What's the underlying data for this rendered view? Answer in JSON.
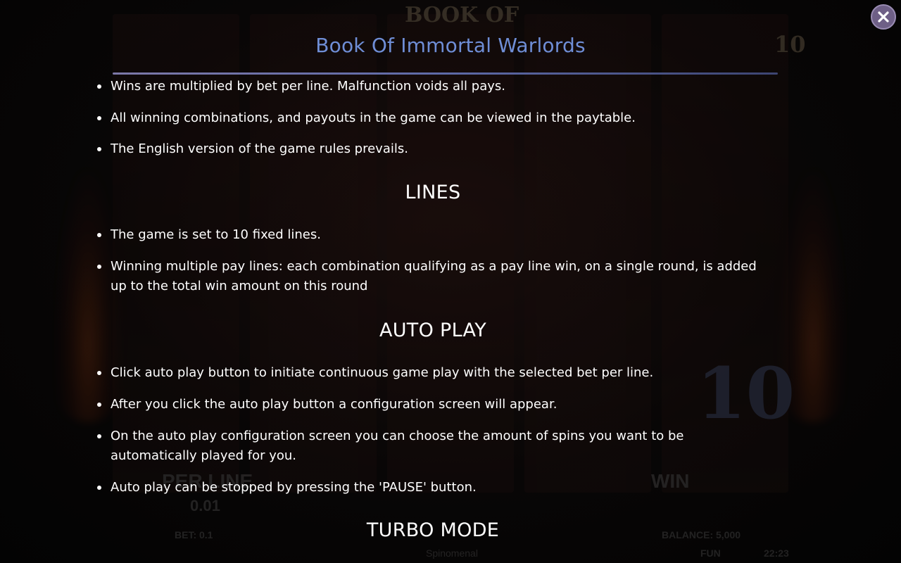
{
  "header": {
    "title": "Book Of Immortal Warlords",
    "close_icon": "close-icon"
  },
  "sections": {
    "general": {
      "items": [
        "Wins are multiplied by bet per line. Malfunction voids all pays.",
        "All winning combinations, and payouts in the game can be viewed in the paytable.",
        "The English version of the game rules prevails."
      ]
    },
    "lines": {
      "heading": "LINES",
      "items": [
        "The game is set to 10 fixed lines.",
        "Winning multiple pay lines: each combination qualifying as a pay line win, on a single round, is added up to the total win amount on this round"
      ]
    },
    "auto_play": {
      "heading": "AUTO PLAY",
      "items": [
        "Click auto play button to initiate continuous game play with the selected bet per line.",
        "After you click the auto play button a configuration screen will appear.",
        "On the auto play configuration screen you can choose the amount of spins you want to be automatically played for you.",
        "Auto play can be stopped by pressing the 'PAUSE' button."
      ]
    },
    "turbo_mode": {
      "heading": "TURBO MODE"
    }
  },
  "background_game": {
    "logo": "BOOK OF",
    "lines_count": "10",
    "big_number": "10",
    "per_line_label": "PER LINE",
    "per_line_value": "0.01",
    "win_label": "WIN",
    "bet": "BET: 0.1",
    "balance": "BALANCE: 5,000",
    "mode": "FUN",
    "time": "22:23",
    "brand": "Spinomenal"
  },
  "colors": {
    "title": "#6f8ed6",
    "text": "#ffffff",
    "close_button": "#6e5f86",
    "divider": "#5e6aa8"
  }
}
